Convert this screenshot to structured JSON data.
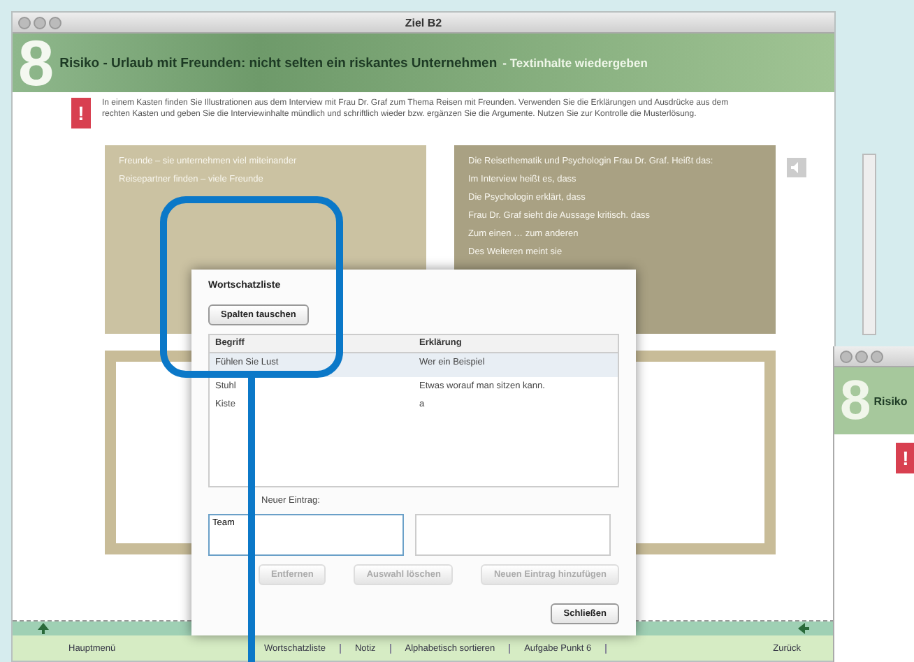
{
  "window": {
    "title": "Ziel B2"
  },
  "header": {
    "number": "8",
    "title": "Risiko - Urlaub mit Freunden: nicht selten ein riskantes Unternehmen",
    "subtitle": "- Textinhalte wiedergeben"
  },
  "instruction": {
    "icon": "!",
    "text": "In einem Kasten finden Sie Illustrationen aus dem Interview mit Frau Dr. Graf zum Thema Reisen mit Freunden. Verwenden Sie die Erklärungen und Ausdrücke aus dem rechten Kasten und geben Sie die Interviewinhalte mündlich und schriftlich wieder bzw. ergänzen Sie die Argumente. Nutzen Sie zur Kontrolle die Musterlösung."
  },
  "left_card": {
    "lines": [
      "Freunde – sie unternehmen viel miteinander",
      "Reisepartner finden – viele Freunde"
    ]
  },
  "right_card": {
    "lines": [
      "Die Reisethematik und Psychologin Frau Dr. Graf. Heißt das:",
      "Im Interview heißt es, dass",
      "Die Psychologin erklärt, dass",
      "Frau Dr. Graf sieht die Aussage kritisch. dass",
      "Zum einen … zum anderen",
      "Des Weiteren meint sie"
    ]
  },
  "dialog": {
    "title": "Wortschatzliste",
    "swap_button": "Spalten tauschen",
    "columns": [
      "Begriff",
      "Erklärung"
    ],
    "rows": [
      {
        "term": "Fühlen Sie Lust",
        "explanation": "Wer ein Beispiel",
        "selected": true
      },
      {
        "term": "Stuhl",
        "explanation": "Etwas worauf man sitzen kann.",
        "selected": false
      },
      {
        "term": "Kiste",
        "explanation": "a",
        "selected": false
      }
    ],
    "new_entry_label": "Neuer Eintrag:",
    "term_value": "Team",
    "buttons": [
      {
        "label": "Entfernen",
        "disabled": true
      },
      {
        "label": "Auswahl löschen",
        "disabled": true
      },
      {
        "label": "Neuen Eintrag hinzufügen",
        "disabled": true
      }
    ],
    "close_button": "Schließen"
  },
  "footer": {
    "items": [
      "Hauptmenü",
      "Wortschatzliste",
      "Notiz",
      "Alphabetisch sortieren",
      "Aufgabe Punkt 6"
    ],
    "back": "Zurück"
  },
  "second_window": {
    "number": "8",
    "title": "Risiko",
    "icon": "!"
  }
}
